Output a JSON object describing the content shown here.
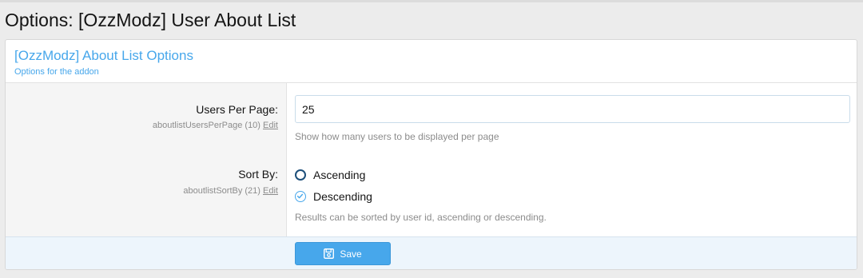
{
  "page": {
    "title": "Options: [OzzModz] User About List"
  },
  "group": {
    "title": "[OzzModz] About List Options",
    "description": "Options for the addon"
  },
  "options": {
    "users_per_page": {
      "label": "Users Per Page:",
      "id_text": "aboutlistUsersPerPage (10)",
      "edit_label": "Edit",
      "value": "25",
      "explain": "Show how many users to be displayed per page"
    },
    "sort_by": {
      "label": "Sort By:",
      "id_text": "aboutlistSortBy (21)",
      "edit_label": "Edit",
      "choices": [
        {
          "label": "Ascending",
          "selected": false
        },
        {
          "label": "Descending",
          "selected": true
        }
      ],
      "explain": "Results can be sorted by user id, ascending or descending."
    }
  },
  "footer": {
    "save_label": "Save"
  },
  "colors": {
    "accent": "#47a7eb",
    "footer_bg": "#edf5fc",
    "label_bg": "#f5f5f5"
  },
  "icons": {
    "save": "floppy-disk-icon",
    "radio_off": "radio-unchecked-icon",
    "radio_on": "radio-checked-icon"
  }
}
